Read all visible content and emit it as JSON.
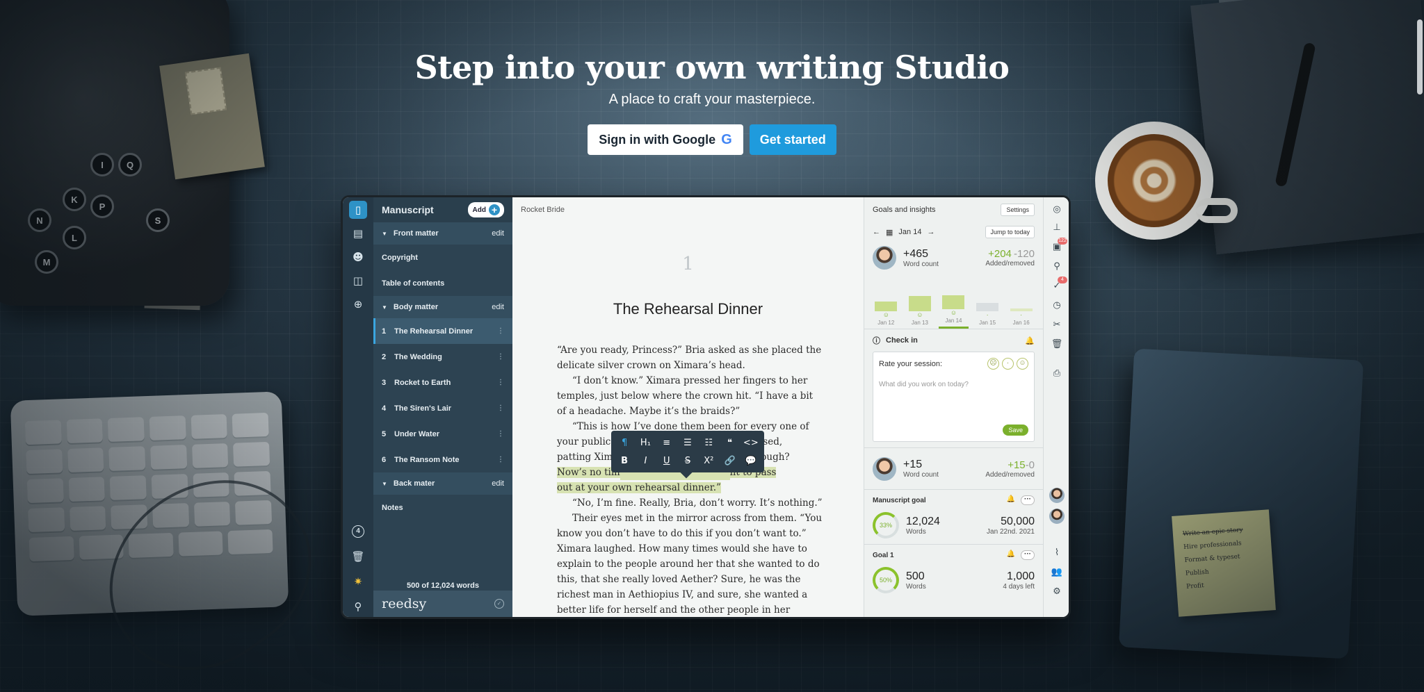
{
  "hero": {
    "title": "Step into your own writing Studio",
    "subtitle": "A place to craft your masterpiece.",
    "google_button": "Sign in with Google",
    "google_icon": "G",
    "start_button": "Get started"
  },
  "app": {
    "sidebar": {
      "title": "Manuscript",
      "add_label": "Add",
      "sections": [
        {
          "label": "Front matter",
          "edit": "edit"
        },
        {
          "label": "Body matter",
          "edit": "edit"
        },
        {
          "label": "Back mater",
          "edit": "edit"
        }
      ],
      "front_items": [
        "Copyright",
        "Table of contents"
      ],
      "chapters": [
        {
          "num": "1",
          "label": "The Rehearsal Dinner"
        },
        {
          "num": "2",
          "label": "The Wedding"
        },
        {
          "num": "3",
          "label": "Rocket to Earth"
        },
        {
          "num": "4",
          "label": "The Siren's Lair"
        },
        {
          "num": "5",
          "label": "Under Water"
        },
        {
          "num": "6",
          "label": "The Ransom Note"
        }
      ],
      "back_items": [
        "Notes"
      ],
      "word_count": "500 of 12,024 words",
      "logo": "reedsy"
    },
    "rail": {
      "badge": "4"
    },
    "editor": {
      "breadcrumb": "Rocket Bride",
      "chapter_number": "1",
      "chapter_title": "The Rehearsal Dinner",
      "paragraphs": [
        "“Are you ready, Princess?” Bria asked as she placed the delicate silver crown on Ximara’s head.",
        "“I don’t know.” Ximara pressed her fingers to her temples, just below where the crown hit. “I have a bit of a headache. Maybe it’s the braids?”",
        "“This is how I’ve done them been for every one of your public appea",
        "“No, I’m fine. Really, Bria, don’t worry. It’s nothing.”",
        "Their eyes met in the mirror across from them. “You know you don’t have to do this if you don’t want to.” Ximara laughed. How many times would she have to explain to the people around her that she wanted to do this, that she really loved Aether? Sure, he was the richest man in Aethiopius IV, and sure, she wanted a better life for herself and the other people in her galaxy, but she wasn’t"
      ],
      "p3_tail1": "she paused,",
      "p3_mid": "patting Xima",
      "p3_tail2": "ough?",
      "hl_start": "Now’s no tim",
      "hl_end": "nt to pass",
      "hl_line2": "out at your own rehearsal dinner.”",
      "toolbar_row1": [
        "¶",
        "H₁",
        "≡",
        "☰",
        "☷",
        "❝",
        "<>"
      ],
      "toolbar_row2": [
        "B",
        "I",
        "U",
        "S",
        "X²",
        "🔗",
        "💬"
      ]
    },
    "insights": {
      "title": "Goals and insights",
      "settings": "Settings",
      "date": "Jan 14",
      "jump": "Jump to today",
      "words_today": "+465",
      "word_count_label": "Word count",
      "added": "+204",
      "removed": "-120",
      "added_removed_label": "Added/removed",
      "days": [
        {
          "label": "Jan 12",
          "level": 0.35
        },
        {
          "label": "Jan 13",
          "level": 0.55
        },
        {
          "label": "Jan 14",
          "level": 0.5
        },
        {
          "label": "Jan 15",
          "level": 0.3
        },
        {
          "label": "Jan 16",
          "level": 0.1
        }
      ],
      "checkin_title": "Check in",
      "rate_label": "Rate your session:",
      "placeholder": "What did you work on today?",
      "save": "Save",
      "user2_words": "+15",
      "user2_added": "+15",
      "user2_removed": "-0",
      "manuscript_goal": {
        "title": "Manuscript goal",
        "percent": "33%",
        "words": "12,024",
        "words_label": "Words",
        "target": "50,000",
        "due": "Jan 22nd. 2021"
      },
      "goal1": {
        "title": "Goal 1",
        "percent": "50%",
        "words": "500",
        "words_label": "Words",
        "target": "1,000",
        "due": "4 days left"
      }
    },
    "right_rail": {
      "badge1": "122",
      "badge2": "4"
    }
  },
  "sticky_note": [
    "Write an epic story",
    "Hire professionals",
    "Format & typeset",
    "Publish",
    "Profit"
  ],
  "colors": {
    "accent": "#1f9bdd",
    "green": "#7bb02c",
    "sidebar": "#2d4352"
  }
}
